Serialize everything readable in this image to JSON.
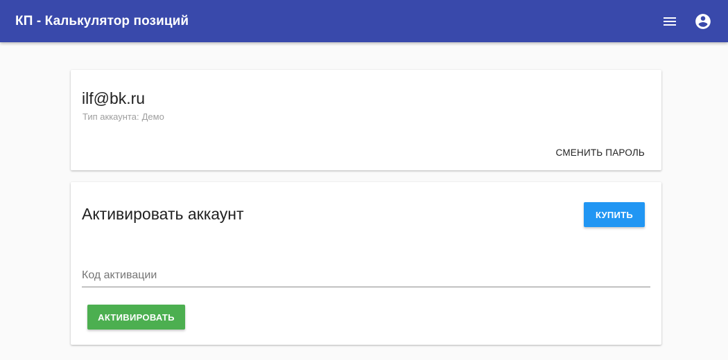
{
  "header": {
    "title": "КП - Калькулятор позиций",
    "background_color": "#3949ab",
    "menu_icon": "menu-icon",
    "account_icon": "account-circle-icon"
  },
  "account_card": {
    "email": "ilf@bk.ru",
    "account_type_label": "Тип аккаунта:",
    "account_type_value": "Демо",
    "change_password_label": "СМЕНИТЬ ПАРОЛЬ"
  },
  "activation_card": {
    "title": "Активировать аккаунт",
    "buy_label": "КУПИТЬ",
    "buy_color": "#2196f3",
    "code_field": {
      "placeholder": "Код активации",
      "value": ""
    },
    "activate_label": "АКТИВИРОВАТЬ",
    "activate_color": "#4caf50"
  }
}
